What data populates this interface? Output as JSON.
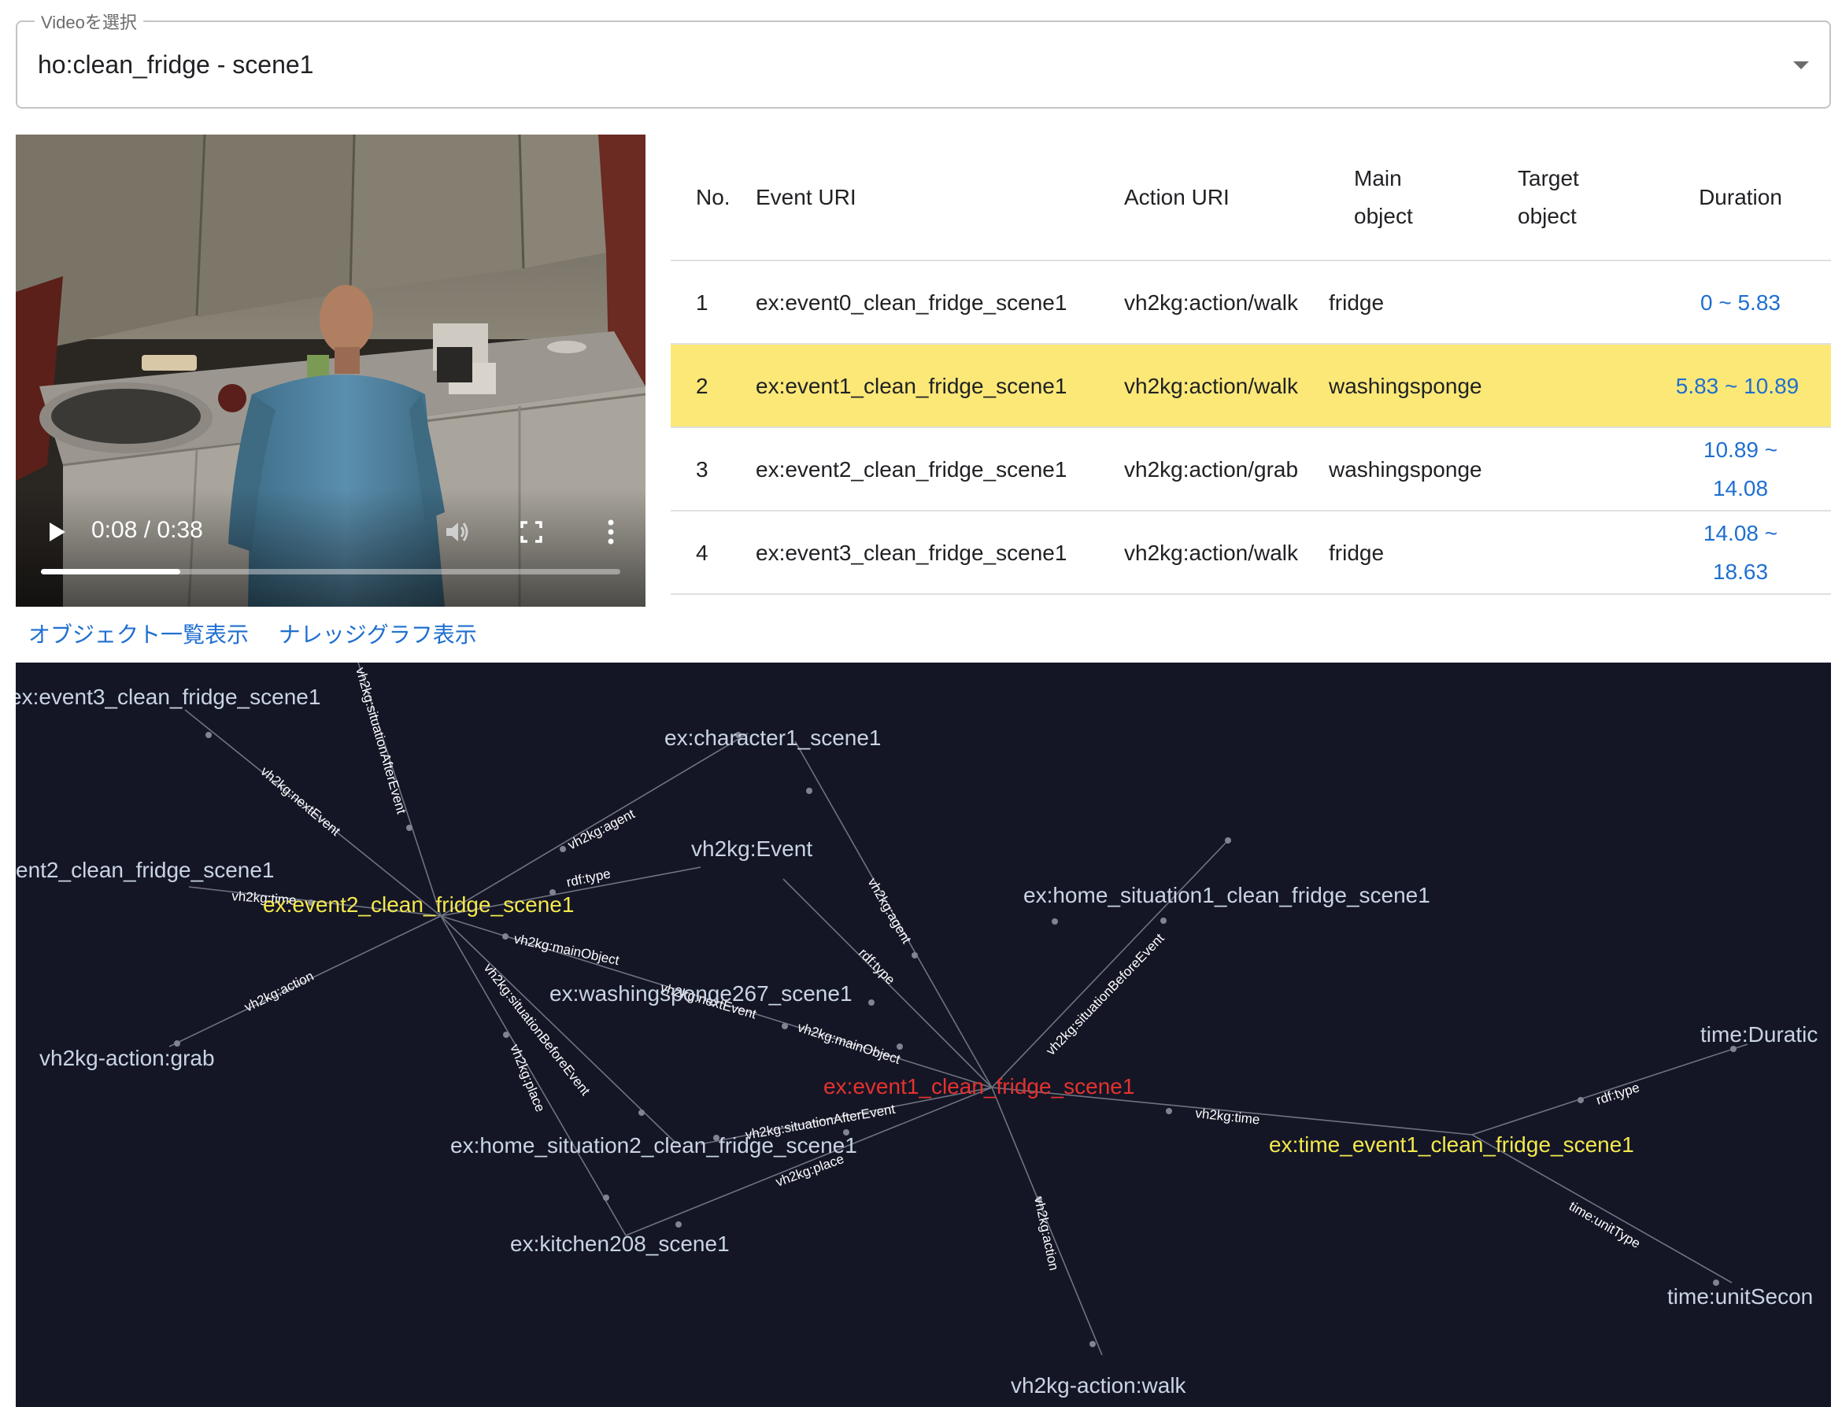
{
  "video_select": {
    "legend": "Videoを選択",
    "value": "ho:clean_fridge - scene1"
  },
  "video_player": {
    "current_time": "0:08",
    "duration": "0:38",
    "time_display": "0:08 / 0:38",
    "progress": 0.24,
    "state": "paused"
  },
  "events_table": {
    "headers": {
      "no": "No.",
      "event_uri": "Event URI",
      "action_uri": "Action URI",
      "main_object_1": "Main",
      "main_object_2": "object",
      "target_object_1": "Target",
      "target_object_2": "object",
      "duration": "Duration"
    },
    "rows": [
      {
        "no": "1",
        "event_uri": "ex:event0_clean_fridge_scene1",
        "action_uri": "vh2kg:action/walk",
        "main_object": "fridge",
        "target_object": "",
        "duration_1": "0 ~ 5.83",
        "duration_2": ""
      },
      {
        "no": "2",
        "event_uri": "ex:event1_clean_fridge_scene1",
        "action_uri": "vh2kg:action/walk",
        "main_object": "washingsponge",
        "target_object": "",
        "duration_1": "5.83 ~ 10.89",
        "duration_2": ""
      },
      {
        "no": "3",
        "event_uri": "ex:event2_clean_fridge_scene1",
        "action_uri": "vh2kg:action/grab",
        "main_object": "washingsponge",
        "target_object": "",
        "duration_1": "10.89 ~",
        "duration_2": "14.08"
      },
      {
        "no": "4",
        "event_uri": "ex:event3_clean_fridge_scene1",
        "action_uri": "vh2kg:action/walk",
        "main_object": "fridge",
        "target_object": "",
        "duration_1": "14.08 ~",
        "duration_2": "18.63"
      }
    ],
    "highlight_row": 2,
    "highlight_color": "#fbe877",
    "link_color": "#1f6fd0"
  },
  "view_links": {
    "object_list": "オブジェクト一覧表示",
    "knowledge_graph": "ナレッジグラフ表示"
  },
  "graph": {
    "background": "#141626",
    "nodes": {
      "event3": "ex:event3_clean_fridge_scene1",
      "character": "ex:character1_scene1",
      "event2_cut": "ent2_clean_fridge_scene1",
      "event2": "ex:event2_clean_fridge_scene1",
      "vh2kg_event": "vh2kg:Event",
      "home_situation1": "ex:home_situation1_clean_fridge_scene1",
      "washingsponge": "ex:washingsponge267_scene1",
      "action_grab": "vh2kg-action:grab",
      "event1": "ex:event1_clean_fridge_scene1",
      "time_duration": "time:Duratic",
      "home_situation2": "ex:home_situation2_clean_fridge_scene1",
      "time_event1": "ex:time_event1_clean_fridge_scene1",
      "kitchen": "ex:kitchen208_scene1",
      "unit_second": "time:unitSecon",
      "action_walk": "vh2kg-action:walk"
    },
    "edges": {
      "situation_after_event_1": "vh2kg:situationAfterEvent",
      "next_event_1": "vh2kg:nextEvent",
      "agent_1": "vh2kg:agent",
      "rdf_type_1": "rdf:type",
      "time_1": "vh2kg:time",
      "main_object_1": "vh2kg:mainObject",
      "next_event_2": "vh2kg:nextEvent",
      "main_object_2": "vh2kg:mainObject",
      "action_1": "vh2kg:action",
      "situation_before_event_1": "vh2kg:situationBeforeEvent",
      "place_1": "vh2kg:place",
      "agent_2": "vh2kg:agent",
      "rdf_type_2": "rdf:type",
      "situation_before_event_2": "vh2kg:situationBeforeEvent",
      "situation_after_event_2": "vh2kg:situationAfterEvent",
      "place_2": "vh2kg:place",
      "time_2": "vh2kg:time",
      "rdf_type_3": "rdf:type",
      "unit_type": "time:unitType",
      "action_2": "vh2kg:action"
    },
    "colors": {
      "default_node": "#c9d4e3",
      "selected_node": "#e5322d",
      "neighbor_node": "#f4e84c"
    }
  }
}
